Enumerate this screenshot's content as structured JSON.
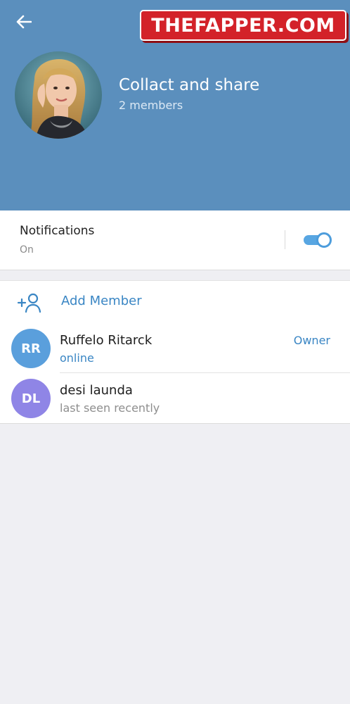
{
  "watermark": {
    "text": "THEFAPPER.COM"
  },
  "group": {
    "title": "Collact and share",
    "members_count": "2 members"
  },
  "notifications": {
    "label": "Notifications",
    "state": "On",
    "enabled": true
  },
  "add_member": {
    "label": "Add Member",
    "icon": "add-user-icon"
  },
  "members": [
    {
      "initials": "RR",
      "name": "Ruffelo Ritarck",
      "status": "online",
      "status_color": "#3a86c4",
      "role": "Owner",
      "avatar_color": "#5a9fdc"
    },
    {
      "initials": "DL",
      "name": "desi launda",
      "status": "last seen recently",
      "status_color": "#8e8e8e",
      "role": "",
      "avatar_color": "#8f85e6"
    }
  ],
  "colors": {
    "header_bg": "#5b8fbd",
    "accent": "#3a86c4",
    "toggle_on": "#58a6e2",
    "page_bg": "#efeff3",
    "watermark_red": "#d32229"
  }
}
